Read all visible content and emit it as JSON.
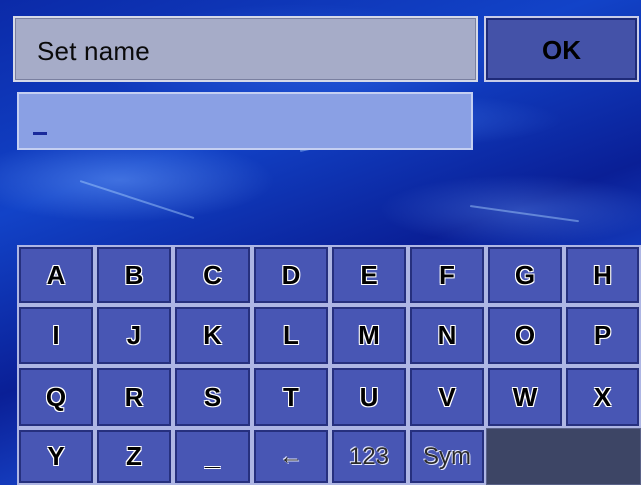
{
  "header": {
    "title": "Set name",
    "ok_label": "OK"
  },
  "input": {
    "value": ""
  },
  "keyboard": {
    "rows": [
      [
        "A",
        "B",
        "C",
        "D",
        "E",
        "F",
        "G",
        "H"
      ],
      [
        "I",
        "J",
        "K",
        "L",
        "M",
        "N",
        "O",
        "P"
      ],
      [
        "Q",
        "R",
        "S",
        "T",
        "U",
        "V",
        "W",
        "X"
      ],
      [
        "Y",
        "Z",
        "_",
        "←",
        "123",
        "Sym"
      ]
    ]
  },
  "colors": {
    "key": "#4856b4",
    "title_box": "#a6acc8",
    "input_box": "#8aa0e4",
    "background": "#0a1a8a"
  }
}
